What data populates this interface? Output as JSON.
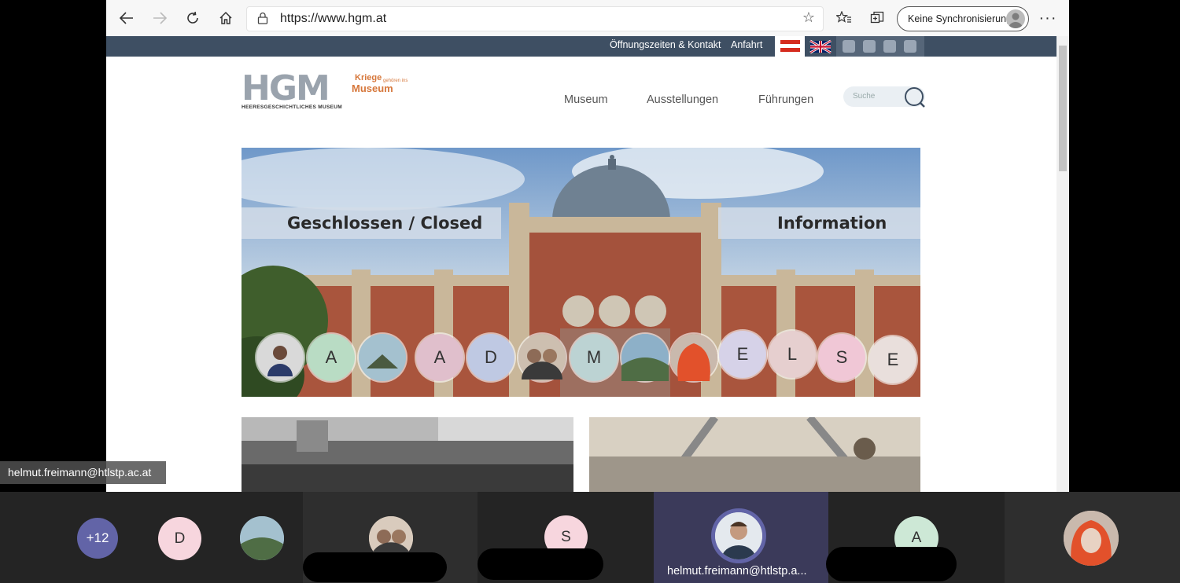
{
  "browser": {
    "url": "https://www.hgm.at",
    "sync_label": "Keine Synchronisierung"
  },
  "site": {
    "top_links": [
      "Öffnungszeiten & Kontakt",
      "Anfahrt"
    ],
    "logo": {
      "main": "HGM",
      "sub": "HEERESGESCHICHTLICHES MUSEUM",
      "tag1": "Kriege",
      "tag2": "gehören ins",
      "tag3": "Museum"
    },
    "nav": [
      "Museum",
      "Ausstellungen",
      "Führungen"
    ],
    "search_placeholder": "Suche",
    "hero_left": "Geschlossen / Closed",
    "hero_right": "Information"
  },
  "hero_participants": [
    "A",
    "A",
    "D",
    "M",
    "E",
    "L",
    "S",
    "E"
  ],
  "colors": {
    "topbar": "#3e4f63",
    "call_bg": "#242424",
    "brand_gray": "#9aa3ad",
    "brand_orange": "#d6773b"
  },
  "call": {
    "presenter_email": "helmut.freimann@htlstp.ac.at",
    "more_count": "+12",
    "strip_letters": [
      "D",
      "S",
      "A"
    ],
    "active_speaker": "helmut.freimann@htlstp.a..."
  }
}
